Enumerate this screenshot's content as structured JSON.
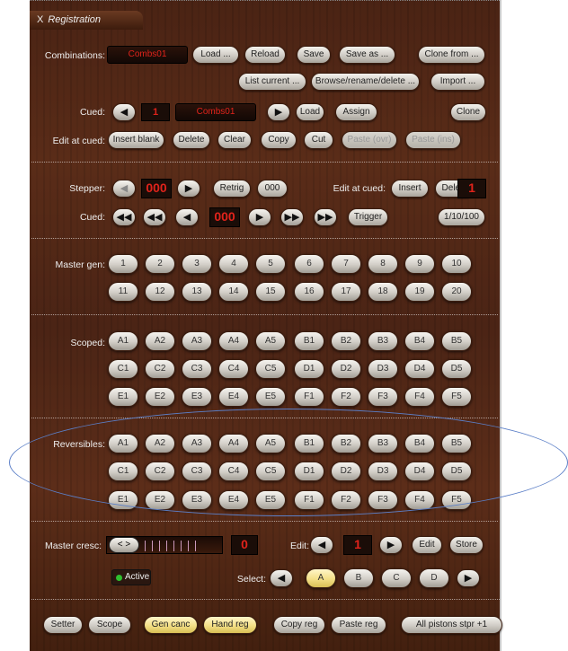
{
  "window": {
    "title": "Registration",
    "close": "X"
  },
  "labels": {
    "combinations": "Combinations:",
    "cued": "Cued:",
    "edit_at_cued": "Edit at cued:",
    "stepper": "Stepper:",
    "stepper_edit": "Edit at cued:",
    "cued2": "Cued:",
    "master_gen": "Master gen:",
    "scoped": "Scoped:",
    "reversibles": "Reversibles:",
    "master_cresc": "Master cresc:",
    "edit": "Edit:",
    "select": "Select:"
  },
  "combo": {
    "name": "Combs01",
    "buttons": [
      "Load ...",
      "Reload",
      "Save",
      "Save as ...",
      "Clone from ..."
    ],
    "row2": [
      "List current ...",
      "Browse/rename/delete ...",
      "Import ..."
    ]
  },
  "cued": {
    "number": "1",
    "name": "Combs01",
    "load": "Load",
    "assign": "Assign",
    "clone": "Clone"
  },
  "edit_cued": {
    "insert_blank": "Insert blank",
    "delete": "Delete",
    "clear": "Clear",
    "copy": "Copy",
    "cut": "Cut",
    "paste_ovr": "Paste (ovr)",
    "paste_ins": "Paste (ins)"
  },
  "stepper": {
    "value": "000",
    "retrig": "Retrig",
    "zero": "000",
    "insert": "Insert",
    "delete": "Delete",
    "count": "1"
  },
  "cued2": {
    "value": "000",
    "trigger": "Trigger",
    "step": "1/10/100"
  },
  "master_gen": [
    "1",
    "2",
    "3",
    "4",
    "5",
    "6",
    "7",
    "8",
    "9",
    "10",
    "11",
    "12",
    "13",
    "14",
    "15",
    "16",
    "17",
    "18",
    "19",
    "20"
  ],
  "scoped": [
    "A1",
    "A2",
    "A3",
    "A4",
    "A5",
    "B1",
    "B2",
    "B3",
    "B4",
    "B5",
    "C1",
    "C2",
    "C3",
    "C4",
    "C5",
    "D1",
    "D2",
    "D3",
    "D4",
    "D5",
    "E1",
    "E2",
    "E3",
    "E4",
    "E5",
    "F1",
    "F2",
    "F3",
    "F4",
    "F5"
  ],
  "reversibles": [
    "A1",
    "A2",
    "A3",
    "A4",
    "A5",
    "B1",
    "B2",
    "B3",
    "B4",
    "B5",
    "C1",
    "C2",
    "C3",
    "C4",
    "C5",
    "D1",
    "D2",
    "D3",
    "D4",
    "D5",
    "E1",
    "E2",
    "E3",
    "E4",
    "E5",
    "F1",
    "F2",
    "F3",
    "F4",
    "F5"
  ],
  "cresc": {
    "value": "0",
    "knob": "< >",
    "active": "Active",
    "edit_value": "1",
    "edit_btn": "Edit",
    "store": "Store"
  },
  "select": {
    "options": [
      "A",
      "B",
      "C",
      "D"
    ],
    "selected": "A"
  },
  "footer": [
    "Setter",
    "Scope",
    "Gen canc",
    "Hand reg",
    "Copy reg",
    "Paste reg",
    "All pistons stpr +1"
  ],
  "icons": {
    "left": "◀",
    "right": "▶",
    "fast_left": "◀◀",
    "fast_right": "▶▶"
  },
  "annotation": {
    "color": "#5b7fc7"
  }
}
